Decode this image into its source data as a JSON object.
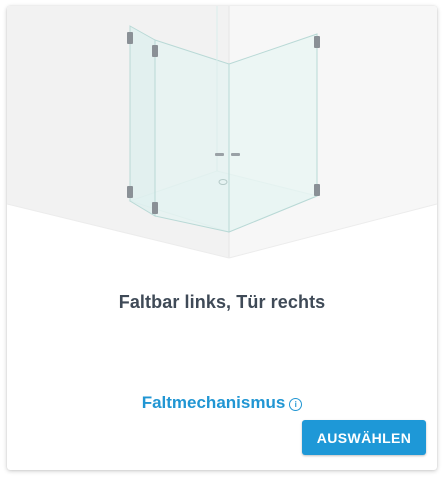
{
  "card": {
    "title": "Faltbar links, Tür rechts",
    "info_link_label": "Faltmechanismus",
    "info_icon": "info-circle-icon",
    "select_button_label": "AUSWÄHLEN"
  },
  "colors": {
    "accent": "#1e98d7",
    "title_text": "#3f4a57",
    "link_text": "#2196d3"
  },
  "image": {
    "subject": "corner shower enclosure illustration",
    "icons": [
      "hinge-icon",
      "handle-icon",
      "drain-icon"
    ]
  }
}
